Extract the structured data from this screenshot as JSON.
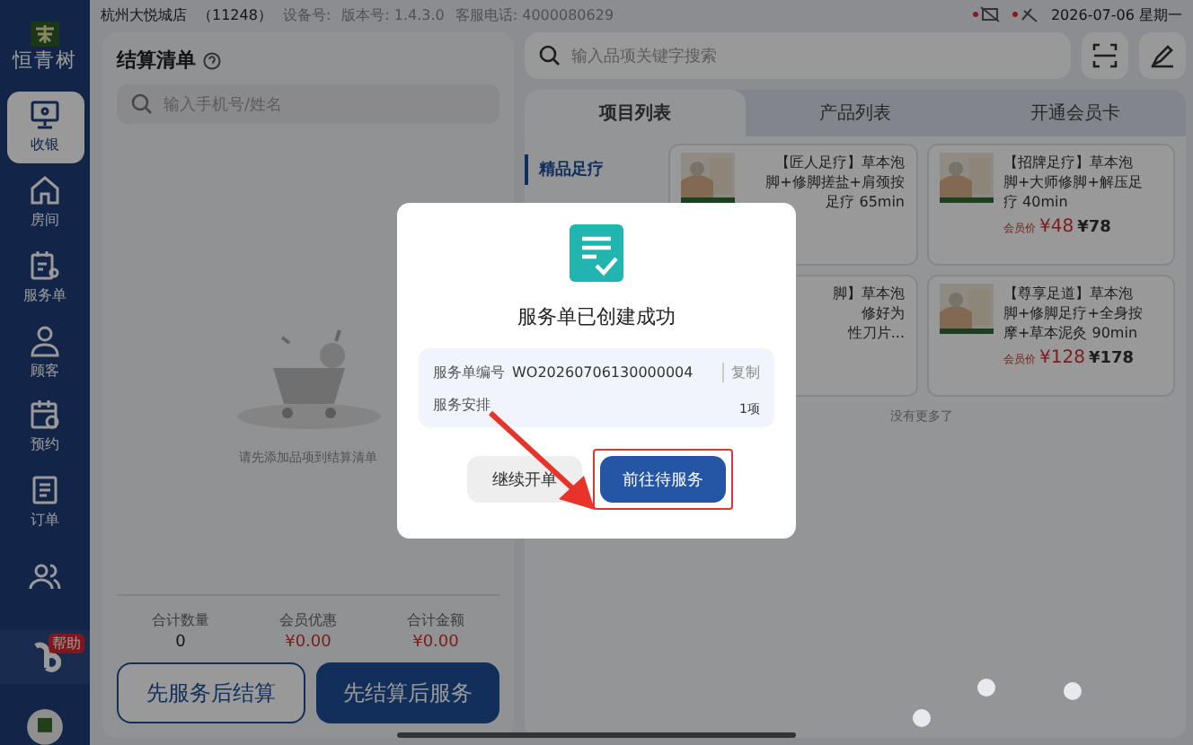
{
  "status_bar": {
    "store": "杭州大悦城店",
    "store_code": "（11248）",
    "device": "设备号:",
    "version": "版本号: 1.4.3.0",
    "hotline": "客服电话: 4000080629",
    "date": "2026-07-06 星期一"
  },
  "sidebar": {
    "logo": "恒青树",
    "items": [
      {
        "label": "收银",
        "selected": true
      },
      {
        "label": "房间",
        "selected": false
      },
      {
        "label": "服务单",
        "selected": false
      },
      {
        "label": "顾客",
        "selected": false
      },
      {
        "label": "预约",
        "selected": false
      },
      {
        "label": "订单",
        "selected": false
      },
      {
        "selected": false
      }
    ],
    "help_badge": "帮助"
  },
  "checkout": {
    "title": "结算清单",
    "search": {
      "placeholder": "输入手机号/姓名"
    },
    "empty_text": "请先添加品项到结算清单",
    "totals": [
      {
        "label": "合计数量",
        "value": "0",
        "kind": "count"
      },
      {
        "label": "会员优惠",
        "value": "¥0.00",
        "kind": "money"
      },
      {
        "label": "合计金额",
        "value": "¥0.00",
        "kind": "money"
      }
    ],
    "buttons": [
      {
        "label": "先服务后结算",
        "kind": "outline"
      },
      {
        "label": "先结算后服务",
        "kind": "primary"
      }
    ]
  },
  "catalog": {
    "search": {
      "placeholder": "输入品项关键字搜索"
    },
    "tabs": [
      {
        "label": "项目列表",
        "selected": true
      },
      {
        "label": "产品列表",
        "selected": false
      },
      {
        "label": "开通会员卡",
        "selected": false
      }
    ],
    "categories": [
      {
        "label": "精品足疗",
        "selected": true
      }
    ],
    "cards": [
      {
        "lines": [
          "【匠人足疗】草本泡",
          "脚+修脚搓盐+肩颈按",
          "足疗 65min"
        ]
      },
      {
        "lines": [
          "【招牌足疗】草本泡",
          "脚+大师修脚+解压足",
          "疗 40min"
        ],
        "member_label": "会员价",
        "member_price": "¥48",
        "price": "¥78"
      },
      {
        "lines": [
          "脚】草本泡",
          "修好为",
          "性刀片..."
        ]
      },
      {
        "lines": [
          "【尊享足道】草本泡",
          "脚+修脚足疗+全身按",
          "摩+草本泥灸 90min"
        ],
        "member_label": "会员价",
        "member_price": "¥128",
        "price": "¥178"
      }
    ],
    "end_text": "没有更多了"
  },
  "dialog": {
    "title": "服务单已创建成功",
    "rows": [
      {
        "label": "服务单编号",
        "value": "WO20260706130000004",
        "action": "复制"
      },
      {
        "label": "服务安排",
        "value": "1项"
      }
    ],
    "buttons": [
      {
        "label": "继续开单",
        "kind": "secondary",
        "highlighted": false
      },
      {
        "label": "前往待服务",
        "kind": "primary",
        "highlighted": true
      }
    ]
  }
}
